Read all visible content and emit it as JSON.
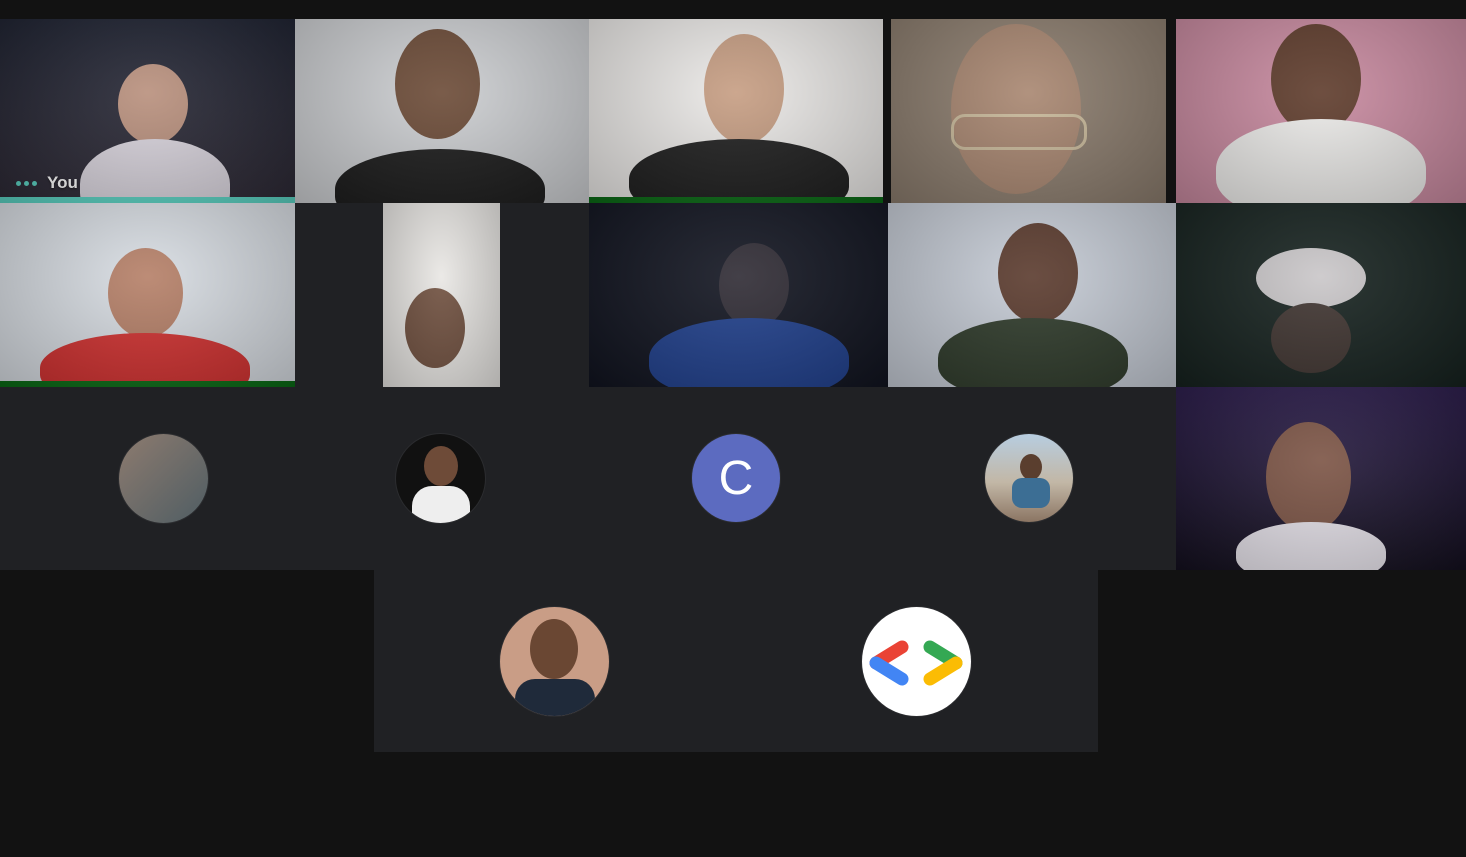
{
  "self_label": "You",
  "letter_avatar": "C",
  "colors": {
    "background": "#121212",
    "tile_dark": "#202124",
    "speaking_teal": "#5bd4c4",
    "speaking_green": "#0b6b16",
    "letter_avatar_bg": "#5c6bc0"
  },
  "participants": [
    {
      "type": "video",
      "is_self": true,
      "speaking": true
    },
    {
      "type": "video"
    },
    {
      "type": "video",
      "speaking": true
    },
    {
      "type": "video"
    },
    {
      "type": "video"
    },
    {
      "type": "video",
      "speaking": true
    },
    {
      "type": "video"
    },
    {
      "type": "video"
    },
    {
      "type": "video"
    },
    {
      "type": "video"
    },
    {
      "type": "avatar",
      "avatar_kind": "photo"
    },
    {
      "type": "avatar",
      "avatar_kind": "photo"
    },
    {
      "type": "avatar",
      "avatar_kind": "letter"
    },
    {
      "type": "avatar",
      "avatar_kind": "photo"
    },
    {
      "type": "video"
    },
    {
      "type": "avatar",
      "avatar_kind": "photo"
    },
    {
      "type": "avatar",
      "avatar_kind": "logo",
      "logo": "developer-code-brackets"
    }
  ]
}
